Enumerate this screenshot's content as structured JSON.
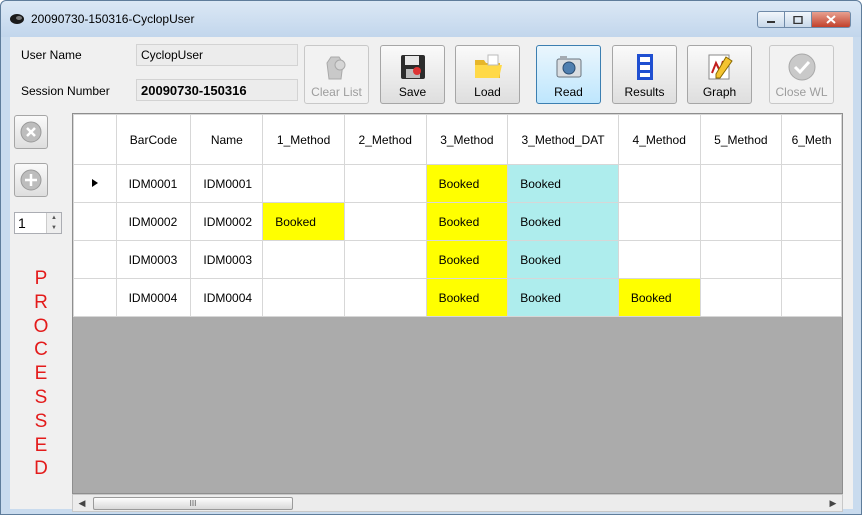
{
  "window": {
    "title": "20090730-150316-CyclopUser"
  },
  "form": {
    "user_name_label": "User Name",
    "user_name_value": "CyclopUser",
    "session_label": "Session Number",
    "session_value": "20090730-150316"
  },
  "toolbar": {
    "buttons": [
      {
        "label": "Clear List",
        "enabled": false
      },
      {
        "label": "Save",
        "enabled": true
      },
      {
        "label": "Load",
        "enabled": true
      },
      {
        "label": "Read",
        "enabled": true,
        "active": true
      },
      {
        "label": "Results",
        "enabled": true
      },
      {
        "label": "Graph",
        "enabled": true
      },
      {
        "label": "Close WL",
        "enabled": false
      }
    ]
  },
  "side": {
    "spinner_value": "1",
    "processed_letters": [
      "P",
      "R",
      "O",
      "C",
      "E",
      "S",
      "S",
      "E",
      "D"
    ]
  },
  "colors": {
    "booked_yellow": "#ffff00",
    "booked_cyan": "#aeeded",
    "processed_red": "#e31b1b"
  },
  "grid": {
    "columns": [
      "BarCode",
      "Name",
      "1_Method",
      "2_Method",
      "3_Method",
      "3_Method_DAT",
      "4_Method",
      "5_Method",
      "6_Meth"
    ],
    "rows": [
      {
        "selected": true,
        "cells": [
          "IDM0001",
          "IDM0001",
          "",
          "",
          "Booked",
          "Booked",
          "",
          "",
          ""
        ]
      },
      {
        "selected": false,
        "cells": [
          "IDM0002",
          "IDM0002",
          "Booked",
          "",
          "Booked",
          "Booked",
          "",
          "",
          ""
        ]
      },
      {
        "selected": false,
        "cells": [
          "IDM0003",
          "IDM0003",
          "",
          "",
          "Booked",
          "Booked",
          "",
          "",
          ""
        ]
      },
      {
        "selected": false,
        "cells": [
          "IDM0004",
          "IDM0004",
          "",
          "",
          "Booked",
          "Booked",
          "Booked",
          "",
          ""
        ]
      }
    ],
    "scroll_thumb_glyph": "III"
  }
}
